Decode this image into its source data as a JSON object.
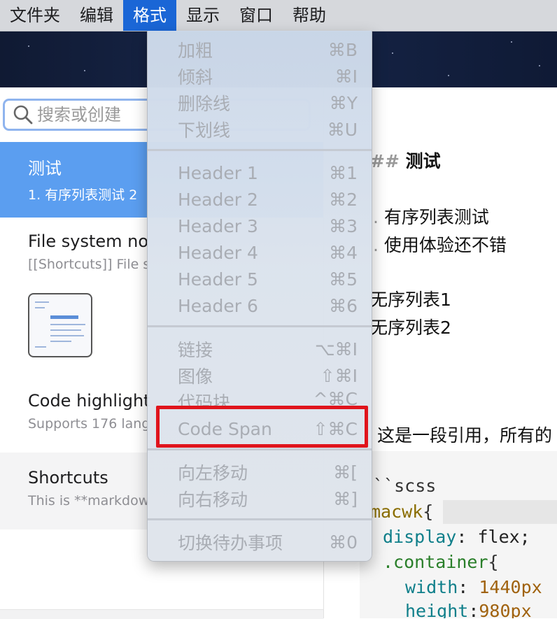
{
  "menubar": {
    "items": [
      {
        "label": "文件夹"
      },
      {
        "label": "编辑"
      },
      {
        "label": "格式"
      },
      {
        "label": "显示"
      },
      {
        "label": "窗口"
      },
      {
        "label": "帮助"
      }
    ],
    "active_index": 2
  },
  "sidebar": {
    "search_placeholder": "搜索或创建",
    "notes": [
      {
        "title": "测试",
        "preview": "1. 有序列表测试 2"
      },
      {
        "title": "File system no",
        "preview": "[[Shortcuts]] File s"
      },
      {
        "title": "Code highlight",
        "preview": "Supports 176 lang"
      },
      {
        "title": "Shortcuts",
        "preview": "This is **markdow"
      }
    ]
  },
  "editor": {
    "heading_marker": "##",
    "heading": "测试",
    "list_marker": ".",
    "ordered": [
      "有序列表测试",
      "使用体验还不错"
    ],
    "unordered": [
      "无序列表1",
      "无序列表2"
    ],
    "quote": "这是一段引用，所有的",
    "code_lines": {
      "l1": "``scss",
      "l2_sel": "macwk",
      "l2_brace": "{",
      "l3_prop": "display",
      "l3_val": ": flex;",
      "l4_cls": ".container",
      "l4_brace": "{",
      "l5_prop": "width",
      "l5_colon": ": ",
      "l5_num": "1440px",
      "l6_prop": "height",
      "l6_colon": ":",
      "l6_num": "980px"
    }
  },
  "format_menu": {
    "items": [
      {
        "label": "加粗",
        "shortcut": "⌘B"
      },
      {
        "label": "倾斜",
        "shortcut": "⌘I"
      },
      {
        "label": "删除线",
        "shortcut": "⌘Y"
      },
      {
        "label": "下划线",
        "shortcut": "⌘U"
      },
      {
        "label": "Header 1",
        "shortcut": "⌘1"
      },
      {
        "label": "Header 2",
        "shortcut": "⌘2"
      },
      {
        "label": "Header 3",
        "shortcut": "⌘3"
      },
      {
        "label": "Header 4",
        "shortcut": "⌘4"
      },
      {
        "label": "Header 5",
        "shortcut": "⌘5"
      },
      {
        "label": "Header 6",
        "shortcut": "⌘6"
      },
      {
        "label": "链接",
        "shortcut": "⌥⌘I"
      },
      {
        "label": "图像",
        "shortcut": "⇧⌘I"
      },
      {
        "label": "代码块",
        "shortcut": "^⌘C"
      },
      {
        "label": "Code Span",
        "shortcut": "⇧⌘C"
      },
      {
        "label": "向左移动",
        "shortcut": "⌘["
      },
      {
        "label": "向右移动",
        "shortcut": "⌘]"
      },
      {
        "label": "切换待办事项",
        "shortcut": "⌘0"
      }
    ],
    "highlighted_item": "Code Span",
    "highlight_color": "#e0141c"
  },
  "colors": {
    "accent": "#1a66d6",
    "selected_note": "#5b9ef0"
  }
}
